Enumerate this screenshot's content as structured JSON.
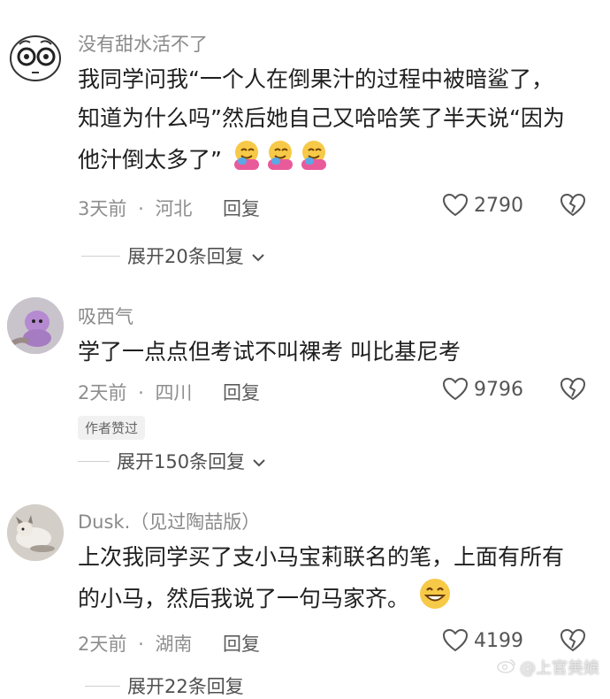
{
  "comments": [
    {
      "username": "没有甜水活不了",
      "text": "我同学问我“一个人在倒果汁的过程中被暗鲨了，知道为什么吗”然后她自己又哈哈笑了半天说“因为他汁倒太多了”",
      "time": "3天前",
      "location": "河北",
      "reply": "回复",
      "likes": "2790",
      "expand": "展开20条回复",
      "avatar_icon": "cartoon-face-icon",
      "trailing_emoji": "hug-emoji"
    },
    {
      "username": "吸西气",
      "text": "学了一点点但考试不叫裸考 叫比基尼考",
      "time": "2天前",
      "location": "四川",
      "reply": "回复",
      "likes": "9796",
      "badge": "作者赞过",
      "expand": "展开150条回复",
      "avatar_icon": "plush-toy-avatar"
    },
    {
      "username": "Dusk.（见过陶喆版）",
      "text": "上次我同学买了支小马宝莉联名的笔，上面有所有的小马，然后我说了一句马家齐。",
      "time": "2天前",
      "location": "湖南",
      "reply": "回复",
      "likes": "4199",
      "expand": "展开22条回复",
      "avatar_icon": "dog-photo-avatar",
      "trailing_emoji": "grin-emoji"
    }
  ],
  "separator": "·",
  "watermark": "@上官美娘",
  "colors": {
    "background": "#ffffff",
    "username": "#8a8a8a",
    "meta": "#8e8e8e",
    "text": "#1f1f1f"
  }
}
